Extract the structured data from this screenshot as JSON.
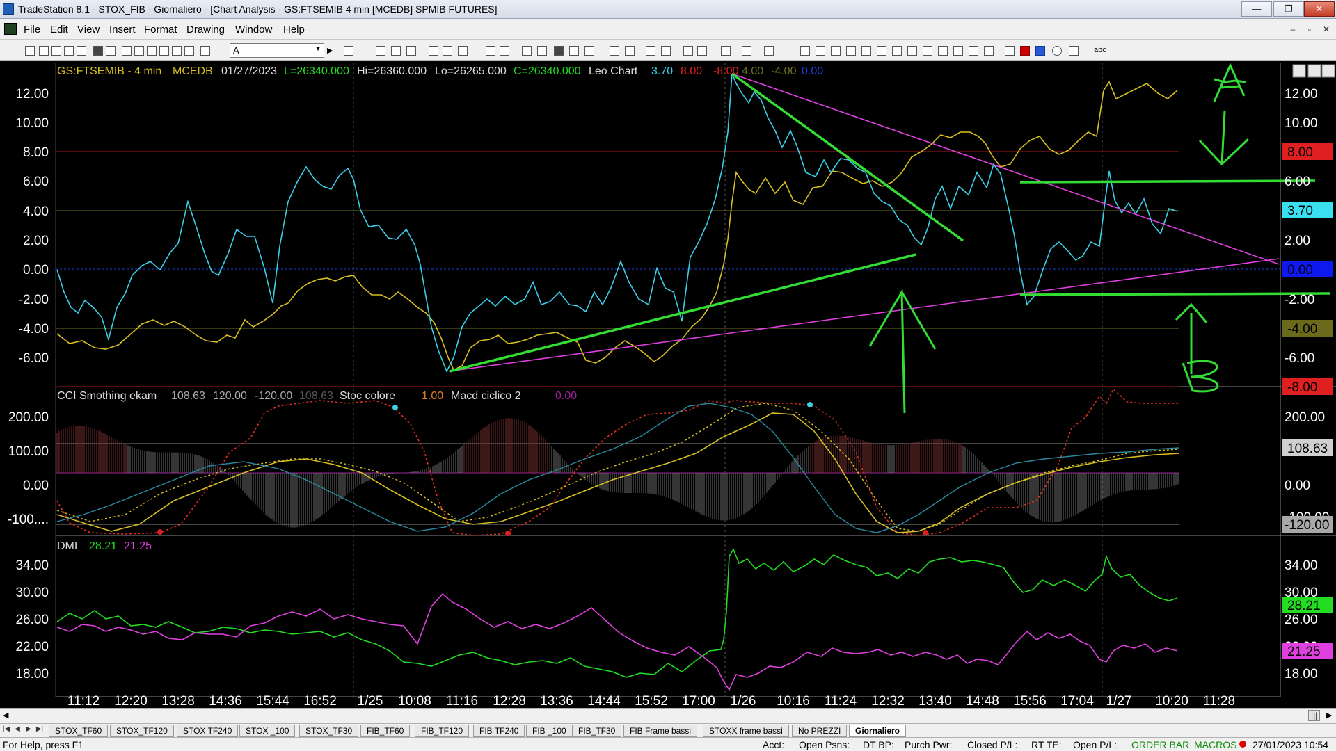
{
  "window": {
    "title": "TradeStation 8.1 - STOX_FIB - Giornaliero - [Chart Analysis - GS:FTSEMIB  4 min  [MCEDB] SPMIB FUTURES]"
  },
  "menu": [
    "File",
    "Edit",
    "View",
    "Insert",
    "Format",
    "Drawing",
    "Window",
    "Help"
  ],
  "toolbar": {
    "symbol_value": "A",
    "text_tool": "abc"
  },
  "chart": {
    "header": {
      "symbol": "GS:FTSEMIB - 4 min",
      "source": "MCEDB",
      "date": "01/27/2023",
      "low_bar": "L=26340.000",
      "hi": "Hi=26360.000",
      "lo": "Lo=26265.000",
      "close": "C=26340.000",
      "study": "Leo Chart",
      "v1": "3.70",
      "v2": "8.00",
      "v3": "-8.00",
      "v4": "4.00",
      "v5": "-4.00",
      "v6": "0.00"
    },
    "colors": {
      "cyan": "#3ad0e8",
      "yellow": "#d8c020",
      "green": "#22dd22",
      "magenta": "#e040e0",
      "red": "#e02020",
      "accent_green": "#33dd33"
    },
    "panel1": {
      "y_ticks": [
        "12.00",
        "10.00",
        "8.00",
        "6.00",
        "4.00",
        "2.00",
        "0.00",
        "-2.00",
        "-4.00",
        "-6.00"
      ],
      "right_ticks": [
        "12.00",
        "10.00",
        "6.00",
        "2.00",
        "-2.00",
        "-6.00"
      ],
      "badges": {
        "b_8": "8.00",
        "b_370": "3.70",
        "b_0": "0.00",
        "b_m4": "-4.00",
        "b_m8": "-8.00"
      },
      "annotations": {
        "top": "A",
        "bottom": "B"
      }
    },
    "panel2": {
      "title": "CCI Smothing ekam",
      "v1": "108.63",
      "v2": "120.00",
      "v3": "-120.00",
      "v4": "108.63",
      "study2": "Stoc colore",
      "study2_val": "1.00",
      "study3": "Macd ciclico 2",
      "study3_val": "0.00",
      "y_ticks": [
        "200.00",
        "100.00",
        "0.00",
        "-100...."
      ],
      "right_ticks": [
        "200.00",
        "0.00",
        "-100.00"
      ],
      "badges": {
        "b_108": "108.63",
        "b_m120": "-120.00"
      }
    },
    "panel3": {
      "title": "DMI",
      "v1": "28.21",
      "v2": "21.25",
      "y_ticks": [
        "34.00",
        "30.00",
        "26.00",
        "22.00",
        "18.00"
      ],
      "right_ticks": [
        "34.00",
        "30.00",
        "26.00",
        "22.00",
        "18.00"
      ],
      "badges": {
        "b_2821": "28.21",
        "b_2125": "21.25"
      }
    },
    "x_labels": [
      "11:12",
      "12:20",
      "13:28",
      "14:36",
      "15:44",
      "16:52",
      "1/25",
      "10:08",
      "11:16",
      "12:28",
      "13:36",
      "14:44",
      "15:52",
      "17:00",
      "1/26",
      "10:16",
      "11:24",
      "12:32",
      "13:40",
      "14:48",
      "15:56",
      "17:04",
      "1/27",
      "10:20",
      "11:28"
    ]
  },
  "tabs": [
    "STOX_TF60",
    "STOX_TF120",
    "STOX TF240",
    "STOX _100",
    "STOX_TF30",
    "FIB_TF60",
    "FIB_TF120",
    "FIB TF240",
    "FIB _100",
    "FIB_TF30",
    "FIB Frame bassi",
    "STOXX frame bassi",
    "No PREZZI",
    "Giornaliero"
  ],
  "status": {
    "help": "For Help, press F1",
    "acct": "Acct:",
    "open_psns": "Open Psns:",
    "dt_bp": "DT BP:",
    "purch_pwr": "Purch Pwr:",
    "closed_pl": "Closed P/L:",
    "rt_te": "RT TE:",
    "open_pl": "Open P/L:",
    "order_bar": "ORDER BAR",
    "macros": "MACROS",
    "datetime": "27/01/2023 10:54"
  }
}
